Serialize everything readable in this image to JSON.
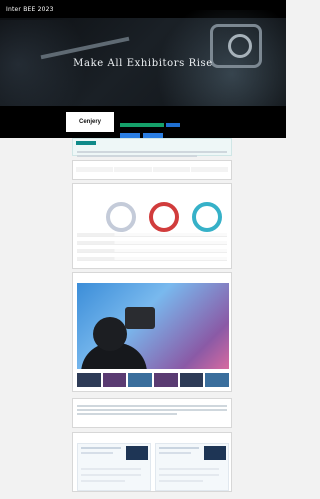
{
  "hero": {
    "brand": "Inter BEE 2023",
    "tagline": "Make All Exhibitors Rise",
    "nav": [
      "",
      "",
      "",
      "",
      "",
      ""
    ]
  },
  "exhibitor": {
    "logo": "Cenjery",
    "name": "",
    "ctas": [
      "",
      ""
    ]
  },
  "sections": {
    "notice_label": "",
    "info_label": "",
    "products_label": "",
    "video_label": "",
    "description_label": "",
    "news_label": ""
  },
  "colors": {
    "hero_bg": "#0b0d10",
    "accent_teal": "#0f8a89",
    "accent_green": "#15a06a",
    "accent_blue": "#2a7de1"
  },
  "icons": [
    "headphones-white-icon",
    "headphones-red-icon",
    "headphones-teal-icon"
  ]
}
